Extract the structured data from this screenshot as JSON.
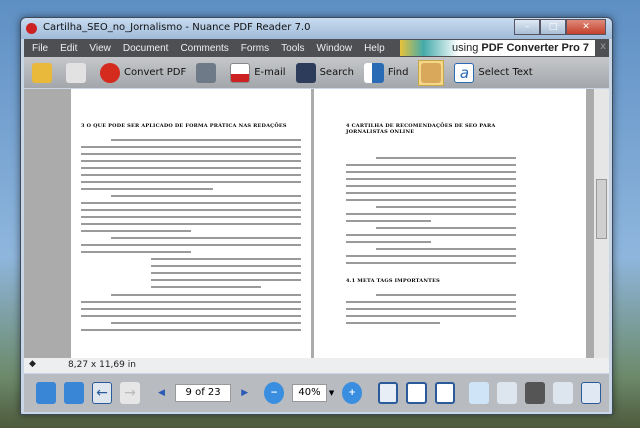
{
  "window": {
    "title": "Cartilha_SEO_no_Jornalismo - Nuance PDF Reader 7.0"
  },
  "menu": [
    "File",
    "Edit",
    "View",
    "Document",
    "Comments",
    "Forms",
    "Tools",
    "Window",
    "Help"
  ],
  "promo": {
    "prefix": "using",
    "product": "PDF Converter Pro 7",
    "close": "x"
  },
  "toolbar": {
    "convert": "Convert PDF",
    "email": "E-mail",
    "search": "Search",
    "find": "Find",
    "select_text": "Select Text"
  },
  "pages": {
    "left_heading": "3   O QUE PODE SER APLICADO DE FORMA PRÁTICA NAS REDAÇÕES",
    "right_heading": "4   CARTILHA DE RECOMENDAÇÕES DE SEO PARA JORNALISTAS ONLINE",
    "right_subheading": "4.1 META TAGS IMPORTANTES"
  },
  "status": {
    "page_size": "8,27 x 11,69 in"
  },
  "nav": {
    "page": "9 of 23",
    "zoom": "40%"
  }
}
